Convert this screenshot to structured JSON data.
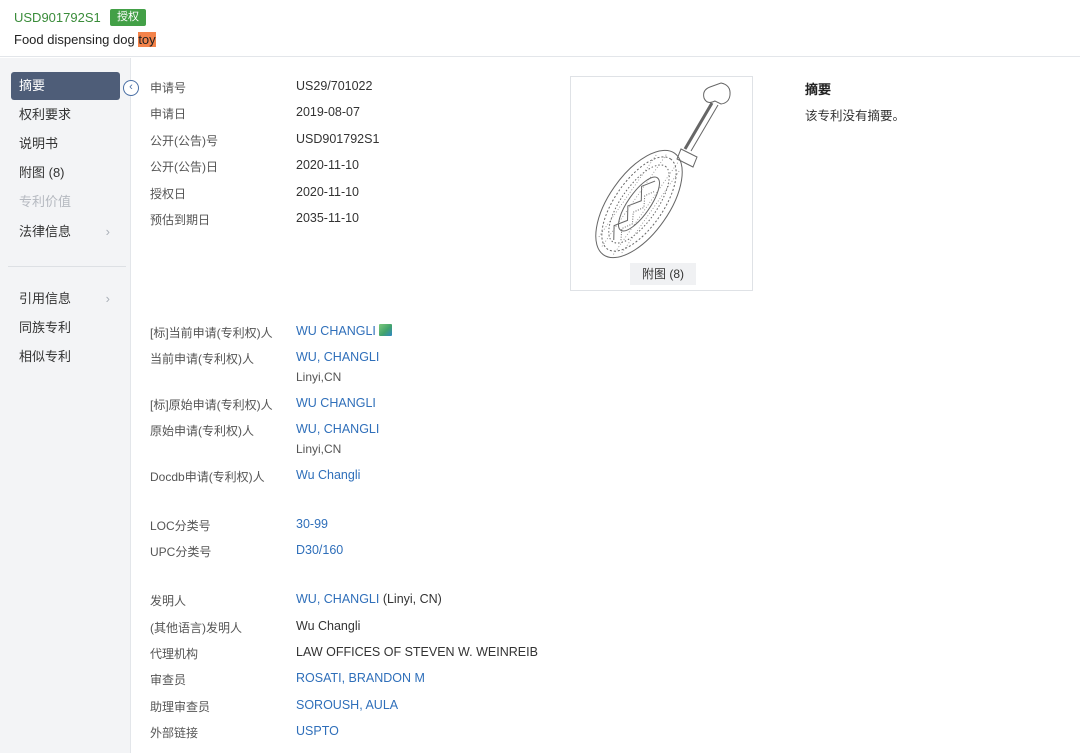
{
  "header": {
    "pub_no": "USD901792S1",
    "status": "授权",
    "title_prefix": "Food dispensing dog ",
    "title_highlight": "toy",
    "status_color": "#43a047",
    "highlight_color": "#f4834a"
  },
  "sidebar": {
    "collapse_icon": "chevron-left-icon",
    "items": [
      {
        "label": "摘要"
      },
      {
        "label": "权利要求"
      },
      {
        "label": "说明书"
      },
      {
        "label": "附图 (8)"
      },
      {
        "label": "专利价值"
      },
      {
        "label": "法律信息"
      },
      {
        "label": "引用信息"
      },
      {
        "label": "同族专利"
      },
      {
        "label": "相似专利"
      }
    ],
    "active_color": "#4e5d78"
  },
  "basic": [
    {
      "label": "申请号",
      "value": "US29/701022"
    },
    {
      "label": "申请日",
      "value": "2019-08-07"
    },
    {
      "label": "公开(公告)号",
      "value": "USD901792S1"
    },
    {
      "label": "公开(公告)日",
      "value": "2020-11-10"
    },
    {
      "label": "授权日",
      "value": "2020-11-10"
    },
    {
      "label": "预估到期日",
      "value": "2035-11-10"
    }
  ],
  "figure": {
    "label": "附图 (8)"
  },
  "abstract": {
    "title": "摘要",
    "text": "该专利没有摘要。"
  },
  "parties": [
    {
      "label": "[标]当前申请(专利权)人",
      "value": "WU CHANGLI"
    },
    {
      "label": "当前申请(专利权)人",
      "value": "WU, CHANGLI",
      "sub": "Linyi,CN"
    },
    {
      "label": "[标]原始申请(专利权)人",
      "value": "WU CHANGLI"
    },
    {
      "label": "原始申请(专利权)人",
      "value": "WU, CHANGLI",
      "sub": "Linyi,CN"
    },
    {
      "label": "Docdb申请(专利权)人",
      "value": "Wu Changli"
    }
  ],
  "classes": [
    {
      "label": "LOC分类号",
      "value": "30-99"
    },
    {
      "label": "UPC分类号",
      "value": "D30/160"
    }
  ],
  "people": [
    {
      "label": "发明人",
      "value": "WU, CHANGLI",
      "extra": " (Linyi, CN)"
    },
    {
      "label": "(其他语言)发明人",
      "value": "Wu Changli"
    },
    {
      "label": "代理机构",
      "value": "LAW OFFICES OF STEVEN W. WEINREIB"
    },
    {
      "label": "审查员",
      "value": "ROSATI, BRANDON M"
    },
    {
      "label": "助理审查员",
      "value": "SOROUSH, AULA"
    },
    {
      "label": "外部链接",
      "value": "USPTO"
    }
  ],
  "colors": {
    "link": "#2f6fba",
    "accent_green": "#3a8c3a"
  }
}
